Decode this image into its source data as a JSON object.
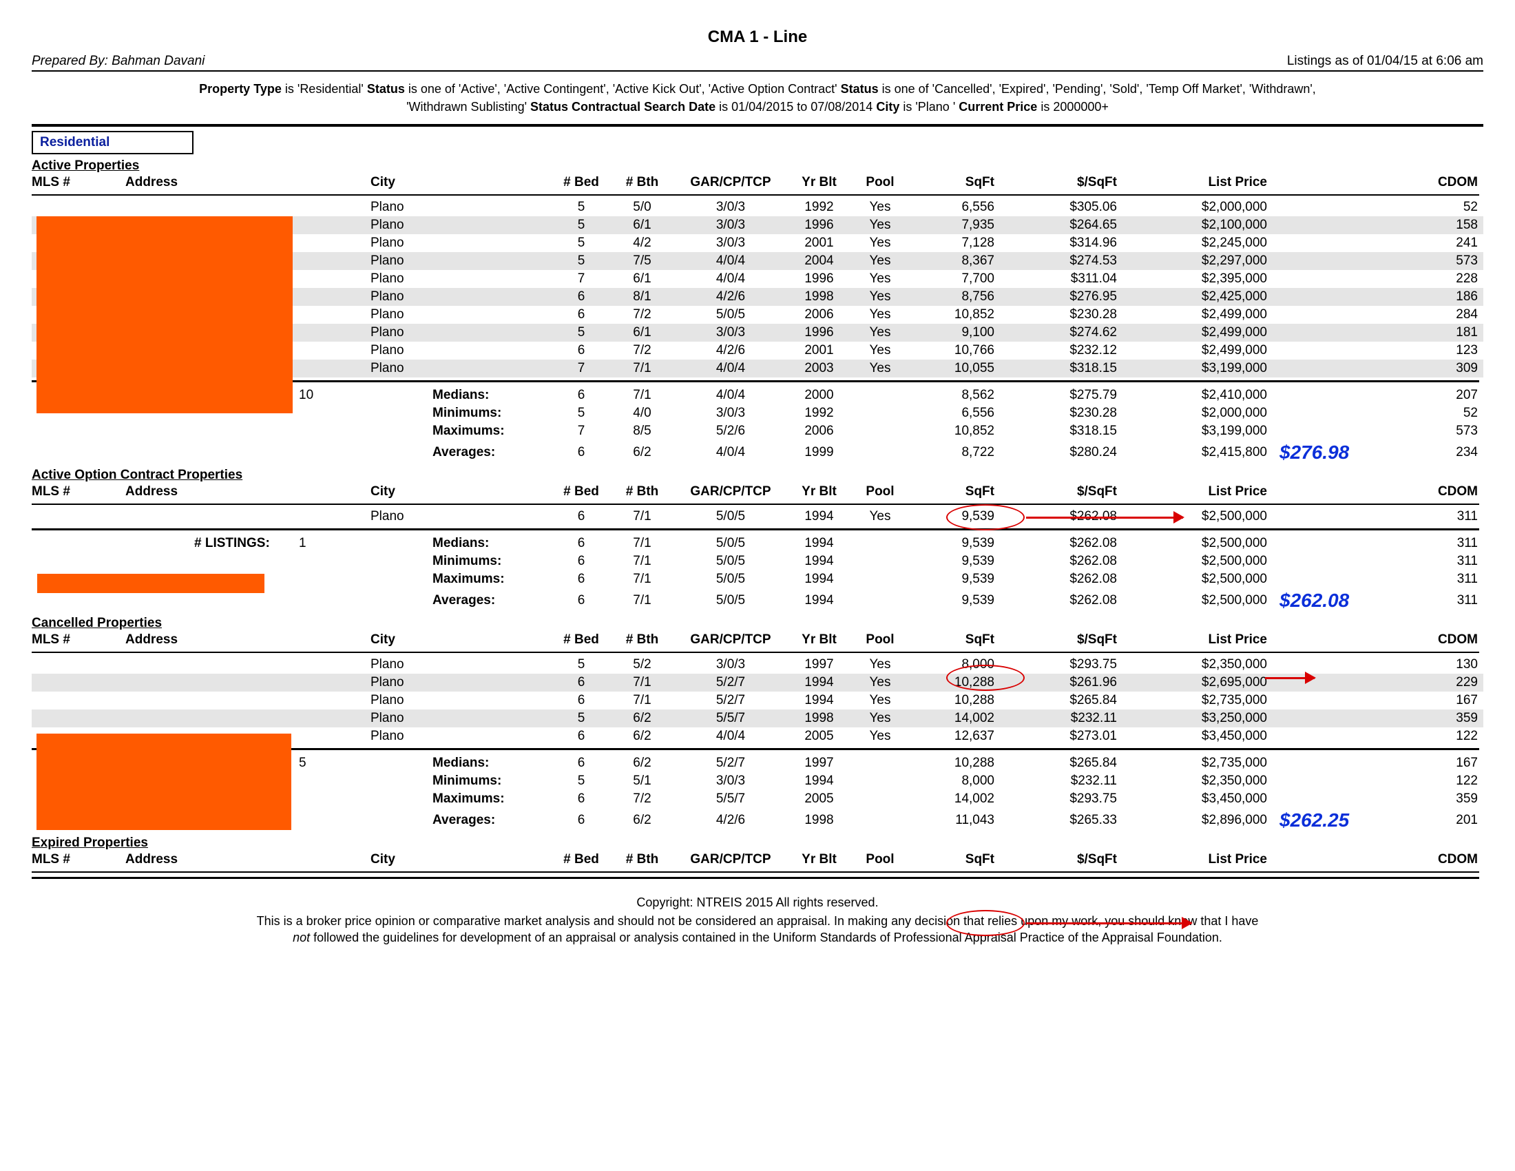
{
  "title": "CMA 1 - Line",
  "preparedBy": "Prepared By: Bahman Davani",
  "listingsAsOf": "Listings as of 01/04/15 at  6:06 am",
  "filters": {
    "l1a": "Property Type",
    "l1av": " is 'Residential'   ",
    "l1b": "Status",
    "l1bv": " is one of 'Active', 'Active Contingent', 'Active Kick Out', 'Active Option Contract'   ",
    "l1c": "Status",
    "l1cv": " is one of 'Cancelled', 'Expired', 'Pending', 'Sold', 'Temp Off Market', 'Withdrawn',",
    "l2a": "'Withdrawn Sublisting'   ",
    "l2b": "Status Contractual Search Date",
    "l2bv": " is 01/04/2015 to 07/08/2014   ",
    "l2c": "City",
    "l2cv": " is 'Plano '   ",
    "l2d": "Current Price",
    "l2dv": " is 2000000+"
  },
  "residentialBox": "Residential",
  "headers": [
    "MLS #",
    "Address",
    "City",
    "# Bed",
    "# Bth",
    "GAR/CP/TCP",
    "Yr Blt",
    "Pool",
    "SqFt",
    "$/SqFt",
    "List Price",
    "",
    "CDOM"
  ],
  "sections": [
    {
      "title": "Active Properties",
      "rows": [
        {
          "city": "Plano",
          "bed": "5",
          "bth": "5/0",
          "gcp": "3/0/3",
          "yr": "1992",
          "pool": "Yes",
          "sqft": "6,556",
          "psf": "$305.06",
          "list": "$2,000,000",
          "cdom": "52"
        },
        {
          "city": "Plano",
          "bed": "5",
          "bth": "6/1",
          "gcp": "3/0/3",
          "yr": "1996",
          "pool": "Yes",
          "sqft": "7,935",
          "psf": "$264.65",
          "list": "$2,100,000",
          "cdom": "158"
        },
        {
          "city": "Plano",
          "bed": "5",
          "bth": "4/2",
          "gcp": "3/0/3",
          "yr": "2001",
          "pool": "Yes",
          "sqft": "7,128",
          "psf": "$314.96",
          "list": "$2,245,000",
          "cdom": "241"
        },
        {
          "city": "Plano",
          "bed": "5",
          "bth": "7/5",
          "gcp": "4/0/4",
          "yr": "2004",
          "pool": "Yes",
          "sqft": "8,367",
          "psf": "$274.53",
          "list": "$2,297,000",
          "cdom": "573"
        },
        {
          "city": "Plano",
          "bed": "7",
          "bth": "6/1",
          "gcp": "4/0/4",
          "yr": "1996",
          "pool": "Yes",
          "sqft": "7,700",
          "psf": "$311.04",
          "list": "$2,395,000",
          "cdom": "228"
        },
        {
          "city": "Plano",
          "bed": "6",
          "bth": "8/1",
          "gcp": "4/2/6",
          "yr": "1998",
          "pool": "Yes",
          "sqft": "8,756",
          "psf": "$276.95",
          "list": "$2,425,000",
          "cdom": "186"
        },
        {
          "city": "Plano",
          "bed": "6",
          "bth": "7/2",
          "gcp": "5/0/5",
          "yr": "2006",
          "pool": "Yes",
          "sqft": "10,852",
          "psf": "$230.28",
          "list": "$2,499,000",
          "cdom": "284"
        },
        {
          "city": "Plano",
          "bed": "5",
          "bth": "6/1",
          "gcp": "3/0/3",
          "yr": "1996",
          "pool": "Yes",
          "sqft": "9,100",
          "psf": "$274.62",
          "list": "$2,499,000",
          "cdom": "181"
        },
        {
          "city": "Plano",
          "bed": "6",
          "bth": "7/2",
          "gcp": "4/2/6",
          "yr": "2001",
          "pool": "Yes",
          "sqft": "10,766",
          "psf": "$232.12",
          "list": "$2,499,000",
          "cdom": "123"
        },
        {
          "city": "Plano",
          "bed": "7",
          "bth": "7/1",
          "gcp": "4/0/4",
          "yr": "2003",
          "pool": "Yes",
          "sqft": "10,055",
          "psf": "$318.15",
          "list": "$3,199,000",
          "cdom": "309"
        }
      ],
      "count": "10",
      "stats": [
        {
          "label": "Medians:",
          "bed": "6",
          "bth": "7/1",
          "gcp": "4/0/4",
          "yr": "2000",
          "sqft": "8,562",
          "psf": "$275.79",
          "list": "$2,410,000",
          "cdom": "207"
        },
        {
          "label": "Minimums:",
          "bed": "5",
          "bth": "4/0",
          "gcp": "3/0/3",
          "yr": "1992",
          "sqft": "6,556",
          "psf": "$230.28",
          "list": "$2,000,000",
          "cdom": "52"
        },
        {
          "label": "Maximums:",
          "bed": "7",
          "bth": "8/5",
          "gcp": "5/2/6",
          "yr": "2006",
          "sqft": "10,852",
          "psf": "$318.15",
          "list": "$3,199,000",
          "cdom": "573"
        },
        {
          "label": "Averages:",
          "bed": "6",
          "bth": "6/2",
          "gcp": "4/0/4",
          "yr": "1999",
          "sqft": "8,722",
          "psf": "$280.24",
          "list": "$2,415,800",
          "cdom": "234"
        }
      ],
      "annot": "$276.98"
    },
    {
      "title": "Active Option Contract Properties",
      "rows": [
        {
          "city": "Plano",
          "bed": "6",
          "bth": "7/1",
          "gcp": "5/0/5",
          "yr": "1994",
          "pool": "Yes",
          "sqft": "9,539",
          "psf": "$262.08",
          "list": "$2,500,000",
          "cdom": "311"
        }
      ],
      "count": "1",
      "stats": [
        {
          "label": "Medians:",
          "bed": "6",
          "bth": "7/1",
          "gcp": "5/0/5",
          "yr": "1994",
          "sqft": "9,539",
          "psf": "$262.08",
          "list": "$2,500,000",
          "cdom": "311"
        },
        {
          "label": "Minimums:",
          "bed": "6",
          "bth": "7/1",
          "gcp": "5/0/5",
          "yr": "1994",
          "sqft": "9,539",
          "psf": "$262.08",
          "list": "$2,500,000",
          "cdom": "311"
        },
        {
          "label": "Maximums:",
          "bed": "6",
          "bth": "7/1",
          "gcp": "5/0/5",
          "yr": "1994",
          "sqft": "9,539",
          "psf": "$262.08",
          "list": "$2,500,000",
          "cdom": "311"
        },
        {
          "label": "Averages:",
          "bed": "6",
          "bth": "7/1",
          "gcp": "5/0/5",
          "yr": "1994",
          "sqft": "9,539",
          "psf": "$262.08",
          "list": "$2,500,000",
          "cdom": "311"
        }
      ],
      "annot": "$262.08"
    },
    {
      "title": "Cancelled Properties",
      "rows": [
        {
          "city": "Plano",
          "bed": "5",
          "bth": "5/2",
          "gcp": "3/0/3",
          "yr": "1997",
          "pool": "Yes",
          "sqft": "8,000",
          "psf": "$293.75",
          "list": "$2,350,000",
          "cdom": "130"
        },
        {
          "city": "Plano",
          "bed": "6",
          "bth": "7/1",
          "gcp": "5/2/7",
          "yr": "1994",
          "pool": "Yes",
          "sqft": "10,288",
          "psf": "$261.96",
          "list": "$2,695,000",
          "cdom": "229"
        },
        {
          "city": "Plano",
          "bed": "6",
          "bth": "7/1",
          "gcp": "5/2/7",
          "yr": "1994",
          "pool": "Yes",
          "sqft": "10,288",
          "psf": "$265.84",
          "list": "$2,735,000",
          "cdom": "167"
        },
        {
          "city": "Plano",
          "bed": "5",
          "bth": "6/2",
          "gcp": "5/5/7",
          "yr": "1998",
          "pool": "Yes",
          "sqft": "14,002",
          "psf": "$232.11",
          "list": "$3,250,000",
          "cdom": "359"
        },
        {
          "city": "Plano",
          "bed": "6",
          "bth": "6/2",
          "gcp": "4/0/4",
          "yr": "2005",
          "pool": "Yes",
          "sqft": "12,637",
          "psf": "$273.01",
          "list": "$3,450,000",
          "cdom": "122"
        }
      ],
      "count": "5",
      "stats": [
        {
          "label": "Medians:",
          "bed": "6",
          "bth": "6/2",
          "gcp": "5/2/7",
          "yr": "1997",
          "sqft": "10,288",
          "psf": "$265.84",
          "list": "$2,735,000",
          "cdom": "167"
        },
        {
          "label": "Minimums:",
          "bed": "5",
          "bth": "5/1",
          "gcp": "3/0/3",
          "yr": "1994",
          "sqft": "8,000",
          "psf": "$232.11",
          "list": "$2,350,000",
          "cdom": "122"
        },
        {
          "label": "Maximums:",
          "bed": "6",
          "bth": "7/2",
          "gcp": "5/5/7",
          "yr": "2005",
          "sqft": "14,002",
          "psf": "$293.75",
          "list": "$3,450,000",
          "cdom": "359"
        },
        {
          "label": "Averages:",
          "bed": "6",
          "bth": "6/2",
          "gcp": "4/2/6",
          "yr": "1998",
          "sqft": "11,043",
          "psf": "$265.33",
          "list": "$2,896,000",
          "cdom": "201"
        }
      ],
      "annot": "$262.25"
    },
    {
      "title": "Expired Properties",
      "rows": [],
      "count": "",
      "stats": [],
      "annot": ""
    }
  ],
  "numListingsLabel": "# LISTINGS:",
  "copyright": "Copyright: NTREIS 2015 All rights reserved.",
  "disclaimerA": "This is a broker price opinion or comparative market analysis and should not be considered an appraisal. In making any decision that relies upon my work, you should know that I have",
  "disclaimerB": "not",
  "disclaimerC": " followed the guidelines for development of an appraisal or analysis contained in the Uniform Standards of Professional Appraisal Practice of the Appraisal Foundation."
}
